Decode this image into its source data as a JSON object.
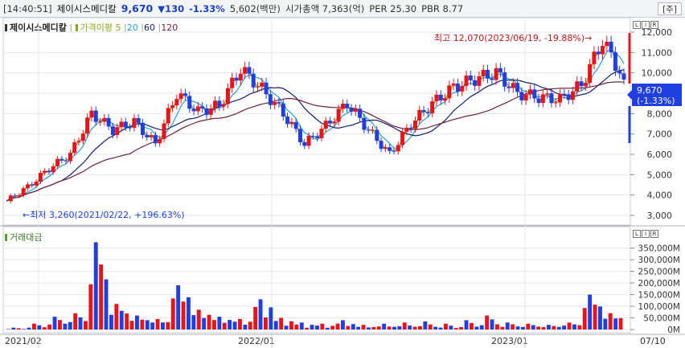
{
  "header": {
    "time": "[14:40:51]",
    "stock_name": "제이시스메디칼",
    "price": "9,670",
    "change_amt": "▼130",
    "change_pct": "-1.33%",
    "turnover": "5,602(백만)",
    "market_cap": "시가총액 7,363(억)",
    "per": "PER 25.30",
    "pbr": "PBR 8.77",
    "market_button": "[주]"
  },
  "price_panel": {
    "legend_name": "제이시스메디칼",
    "legend_ma_label": "가격이평 5",
    "legend_ma20": "20",
    "legend_ma60": "60",
    "legend_ma120": "120",
    "high_annotation": "최고 12,070(2023/06/19, -19.88%)→",
    "low_annotation": "←최저 3,260(2021/02/22, +196.63%)",
    "current_price_label": "9,670",
    "current_pct_label": "(-1.33%)",
    "y_ticks": [
      "12,000",
      "11,000",
      "10,000",
      "9,000",
      "8,000",
      "7,000",
      "6,000",
      "5,000",
      "4,000",
      "3,000"
    ]
  },
  "volume_panel": {
    "legend": "거래대금",
    "y_ticks": [
      "350,000M",
      "300,000M",
      "250,000M",
      "200,000M",
      "150,000M",
      "100,000M",
      "50,000M",
      "0M"
    ]
  },
  "panel_buttons": [
    "L",
    "I",
    "R"
  ],
  "x_axis": {
    "labels": [
      "2021/02",
      "2022/01",
      "2023/01",
      "07/10"
    ]
  },
  "colors": {
    "up": "#e8141a",
    "down": "#1f3fe0",
    "ma5": "#8fa51a",
    "ma20": "#1fa3d3",
    "ma60": "#0f1f6e",
    "ma120": "#6e1f3e",
    "grid": "#e3e6ea"
  },
  "chart_data": [
    {
      "type": "candlestick",
      "title": "",
      "y_scale": [
        3000,
        12000
      ],
      "high": {
        "value": 12070,
        "date": "2023/06/19"
      },
      "low": {
        "value": 3260,
        "date": "2021/02/22"
      },
      "last_close": 9670,
      "series": [
        {
          "name": "5",
          "kind": "moving_average"
        },
        {
          "name": "20",
          "kind": "moving_average"
        },
        {
          "name": "60",
          "kind": "moving_average"
        },
        {
          "name": "120",
          "kind": "moving_average"
        }
      ],
      "x": [
        "2021/02",
        "2021/03",
        "2021/04",
        "2021/05",
        "2021/06",
        "2021/07",
        "2021/08",
        "2021/09",
        "2021/10",
        "2021/11",
        "2021/12",
        "2022/01",
        "2022/02",
        "2022/03",
        "2022/04",
        "2022/05",
        "2022/06",
        "2022/07",
        "2022/08",
        "2022/09",
        "2022/10",
        "2022/11",
        "2022/12",
        "2023/01",
        "2023/02",
        "2023/03",
        "2023/04",
        "2023/05",
        "2023/06",
        "2023/07"
      ],
      "close": [
        3700,
        4400,
        5300,
        6000,
        8000,
        7200,
        7600,
        6500,
        9000,
        8100,
        8400,
        10200,
        9200,
        8000,
        6500,
        7400,
        8500,
        7200,
        6000,
        7500,
        8500,
        9300,
        9700,
        10000,
        9000,
        8800,
        8700,
        9400,
        11600,
        9670
      ]
    },
    {
      "type": "bar",
      "title": "",
      "ylabel": "",
      "ylim": [
        0,
        380000
      ],
      "x": [
        "2021/02",
        "2021/03",
        "2021/04",
        "2021/05",
        "2021/06",
        "2021/07",
        "2021/08",
        "2021/09",
        "2021/10",
        "2021/11",
        "2021/12",
        "2022/01",
        "2022/02",
        "2022/03",
        "2022/04",
        "2022/05",
        "2022/06",
        "2022/07",
        "2022/08",
        "2022/09",
        "2022/10",
        "2022/11",
        "2022/12",
        "2023/01",
        "2023/02",
        "2023/03",
        "2023/04",
        "2023/05",
        "2023/06",
        "2023/07"
      ],
      "values": [
        8000,
        25000,
        55000,
        70000,
        375000,
        110000,
        60000,
        45000,
        190000,
        85000,
        55000,
        45000,
        130000,
        50000,
        30000,
        25000,
        40000,
        20000,
        25000,
        30000,
        35000,
        25000,
        40000,
        60000,
        30000,
        25000,
        20000,
        30000,
        150000,
        70000
      ]
    }
  ]
}
